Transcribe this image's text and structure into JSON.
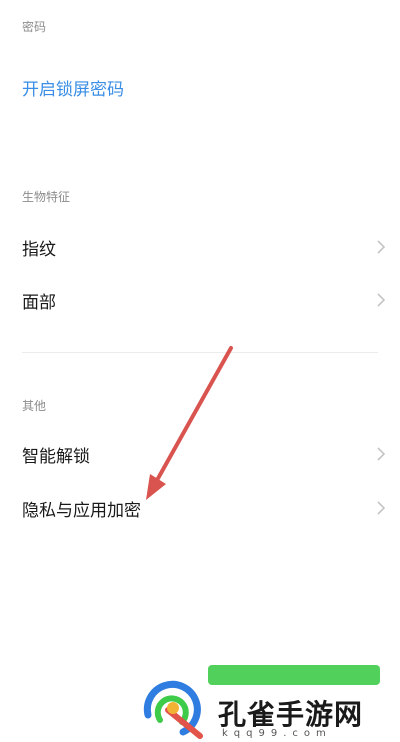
{
  "sections": {
    "password": {
      "header": "密码",
      "action_label": "开启锁屏密码"
    },
    "biometrics": {
      "header": "生物特征",
      "items": [
        {
          "label": "指纹"
        },
        {
          "label": "面部"
        }
      ]
    },
    "other": {
      "header": "其他",
      "items": [
        {
          "label": "智能解锁"
        },
        {
          "label": "隐私与应用加密"
        }
      ]
    }
  },
  "icons": {
    "row_chevron": "chevron-right-icon",
    "annotation": "red-arrow-annotation"
  },
  "colors": {
    "accent": "#3a8ee6",
    "section_header": "#8c8c8c",
    "annotation_arrow": "#d9534f",
    "watermark_banner": "#3ecb4a"
  },
  "watermark": {
    "name": "孔雀手游网",
    "domain": "kqq99.com"
  }
}
